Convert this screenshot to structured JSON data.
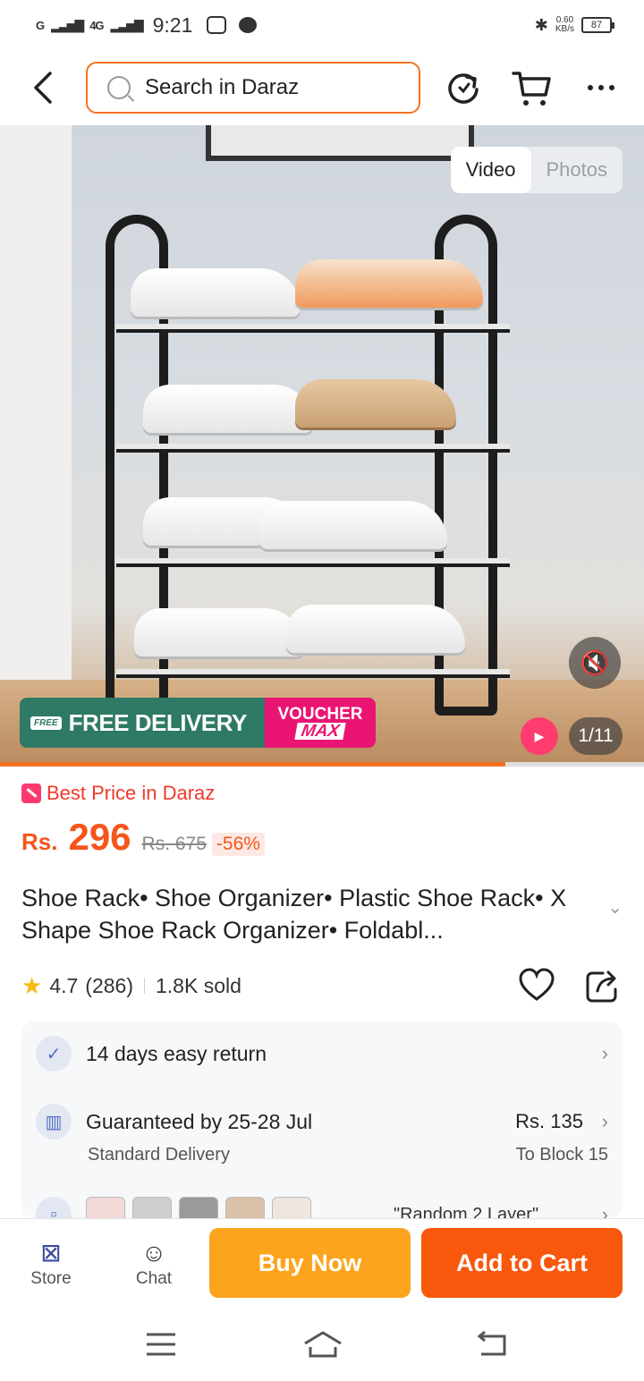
{
  "status_bar": {
    "signal_1": "G",
    "signal_2": "4G",
    "time": "9:21",
    "net_speed": "0.60",
    "net_unit": "KB/s",
    "battery": "87"
  },
  "search": {
    "placeholder": "Search in Daraz"
  },
  "media": {
    "tabs": [
      "Video",
      "Photos"
    ],
    "active_tab": "Video",
    "counter": "1/11",
    "promo_free": "FREE DELIVERY",
    "promo_free_badge": "FREE",
    "promo_voucher_top": "VOUCHER",
    "promo_voucher_bottom": "MAX",
    "progress_fraction": 0.785
  },
  "product": {
    "badge": "Best Price in Daraz",
    "currency": "Rs.",
    "price": "296",
    "original_price": "Rs. 675",
    "discount": "-56%",
    "title": "Shoe Rack• Shoe Organizer• Plastic Shoe Rack• X Shape Shoe Rack Organizer• Foldabl...",
    "rating": "4.7",
    "reviews": "(286)",
    "sold": "1.8K sold"
  },
  "delivery": {
    "return_text": "14 days easy return",
    "guarantee_text": "Guaranteed by 25-28 Jul",
    "delivery_type": "Standard Delivery",
    "delivery_fee": "Rs. 135",
    "destination": "To Block 15",
    "variant_text": "\"Random 2 Layer\""
  },
  "bottom_bar": {
    "store_label": "Store",
    "chat_label": "Chat",
    "buy_now": "Buy Now",
    "add_to_cart": "Add to Cart"
  },
  "colors": {
    "accent": "#f57224",
    "buy_now": "#fca41e",
    "add_to_cart": "#f8580c",
    "price": "#f5551b"
  },
  "icons": [
    "back-icon",
    "search-icon",
    "share-refresh-icon",
    "cart-icon",
    "more-icon",
    "mute-icon",
    "video-icon",
    "star-icon",
    "heart-icon",
    "share-icon",
    "shield-check-icon",
    "gift-icon",
    "store-icon",
    "chat-icon",
    "menu-icon",
    "home-icon",
    "back-nav-icon"
  ]
}
